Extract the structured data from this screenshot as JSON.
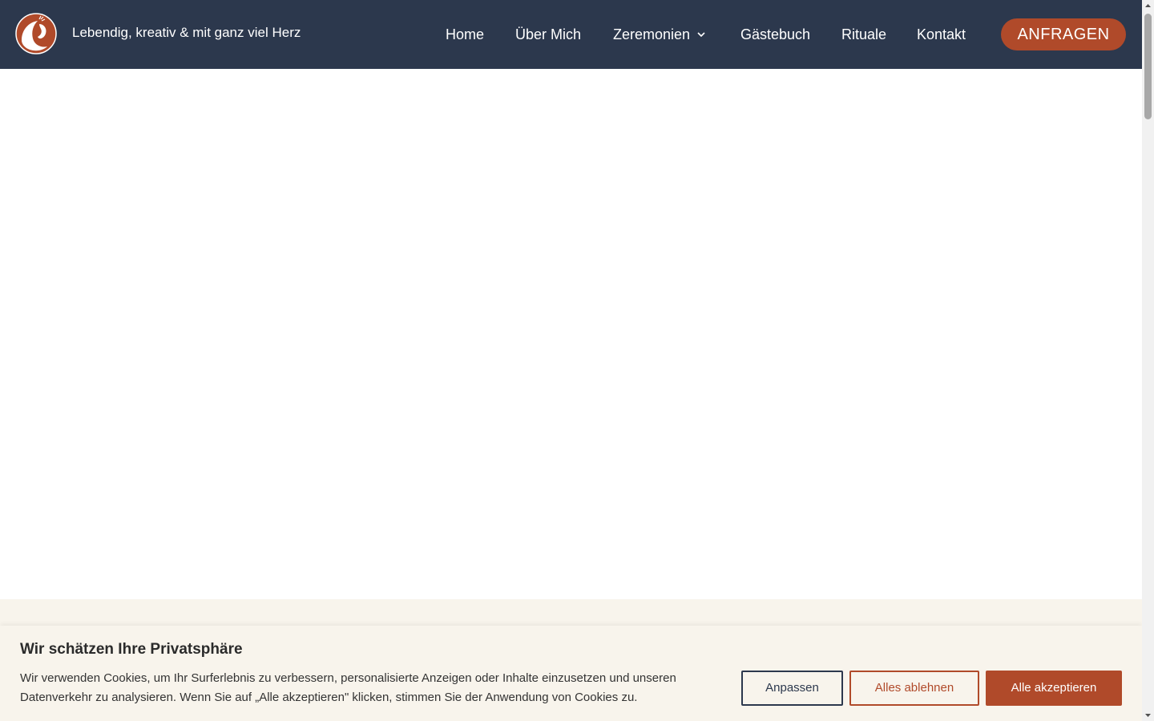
{
  "header": {
    "tagline": "Lebendig, kreativ & mit ganz viel Herz",
    "logo_icon": "peacock-logo-icon",
    "nav": [
      {
        "label": "Home"
      },
      {
        "label": "Über Mich"
      },
      {
        "label": "Zeremonien",
        "dropdown": true
      },
      {
        "label": "Gästebuch"
      },
      {
        "label": "Rituale"
      },
      {
        "label": "Kontakt"
      }
    ],
    "cta_label": "ANFRAGEN"
  },
  "cookie_banner": {
    "title": "Wir schätzen Ihre Privatsphäre",
    "text": "Wir verwenden Cookies, um Ihr Surferlebnis zu verbessern, personalisierte Anzeigen oder Inhalte einzusetzen und unseren Datenverkehr zu analysieren. Wenn Sie auf „Alle akzeptieren\" klicken, stimmen Sie der Anwendung von Cookies zu.",
    "customize_label": "Anpassen",
    "reject_label": "Alles ablehnen",
    "accept_label": "Alle akzeptieren"
  },
  "colors": {
    "header_bg": "#2c384d",
    "accent": "#b04a2a",
    "banner_bg": "#f8f4ec"
  }
}
